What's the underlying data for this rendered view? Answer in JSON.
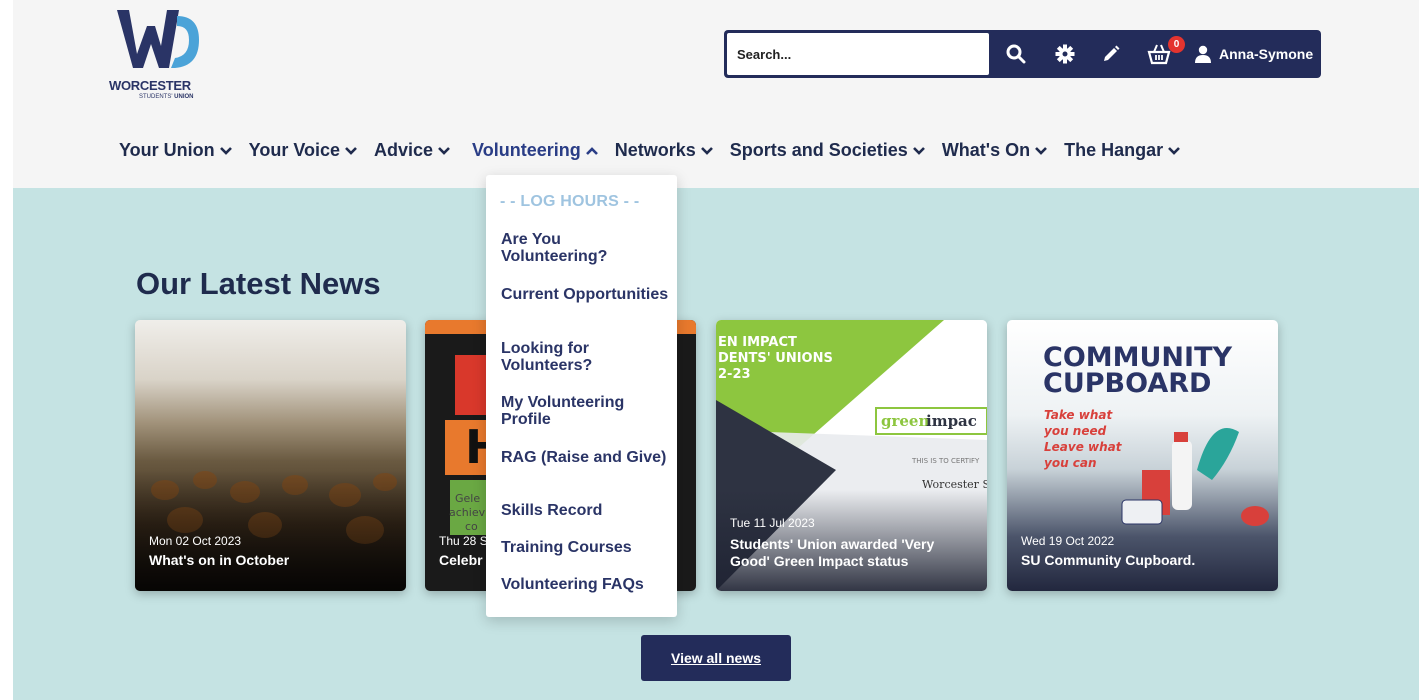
{
  "logo": {
    "word": "WORCESTER",
    "sub_prefix": "STUDENTS'",
    "sub_strong": "UNION"
  },
  "toolbar": {
    "search_placeholder": "Search...",
    "cart_count": "0",
    "user_name": "Anna-Symone",
    "icons": [
      "search-icon",
      "gear-icon",
      "pencil-icon",
      "basket-icon",
      "user-icon"
    ]
  },
  "nav": {
    "items": [
      {
        "label": "Your Union"
      },
      {
        "label": "Your Voice"
      },
      {
        "label": "Advice"
      },
      {
        "label": "Volunteering"
      },
      {
        "label": "Networks"
      },
      {
        "label": "Sports and Societies"
      },
      {
        "label": "What's On"
      },
      {
        "label": "The Hangar"
      }
    ]
  },
  "dropdown": {
    "header": "- - LOG HOURS - -",
    "items": [
      {
        "label": "Are You Volunteering?"
      },
      {
        "label": "Current Opportunities"
      },
      {
        "label": "Looking for Volunteers?"
      },
      {
        "label": "My Volunteering Profile"
      },
      {
        "label": "RAG (Raise and Give)"
      },
      {
        "label": "Skills Record"
      },
      {
        "label": "Training Courses"
      },
      {
        "label": "Volunteering FAQs"
      }
    ]
  },
  "news": {
    "title": "Our Latest News",
    "cards": [
      {
        "date": "Mon 02 Oct 2023",
        "title": "What's on in October"
      },
      {
        "date": "Thu 28 S",
        "title": "Celebr",
        "image_text": [
          "Gele",
          "achiev",
          "co"
        ]
      },
      {
        "date": "Tue 11 Jul 2023",
        "title": "Students' Union awarded 'Very Good' Green Impact status",
        "image_text": [
          "EN IMPACT",
          "DENTS' UNIONS",
          "2-23",
          "green",
          "impac",
          "THIS IS TO CERTIFY",
          "Worcester SU"
        ]
      },
      {
        "date": "Wed 19 Oct 2022",
        "title": "SU Community Cupboard.",
        "image_text": [
          "COMMUNITY",
          "CUPBOARD",
          "Take what",
          "you need",
          "Leave what",
          "you can"
        ]
      }
    ],
    "view_all": "View all news"
  },
  "colors": {
    "navy": "#232c5a",
    "text": "#1f2b4d",
    "teal_bg": "#c5e3e3",
    "green": "#8dc63f",
    "badge": "#e4342f"
  }
}
